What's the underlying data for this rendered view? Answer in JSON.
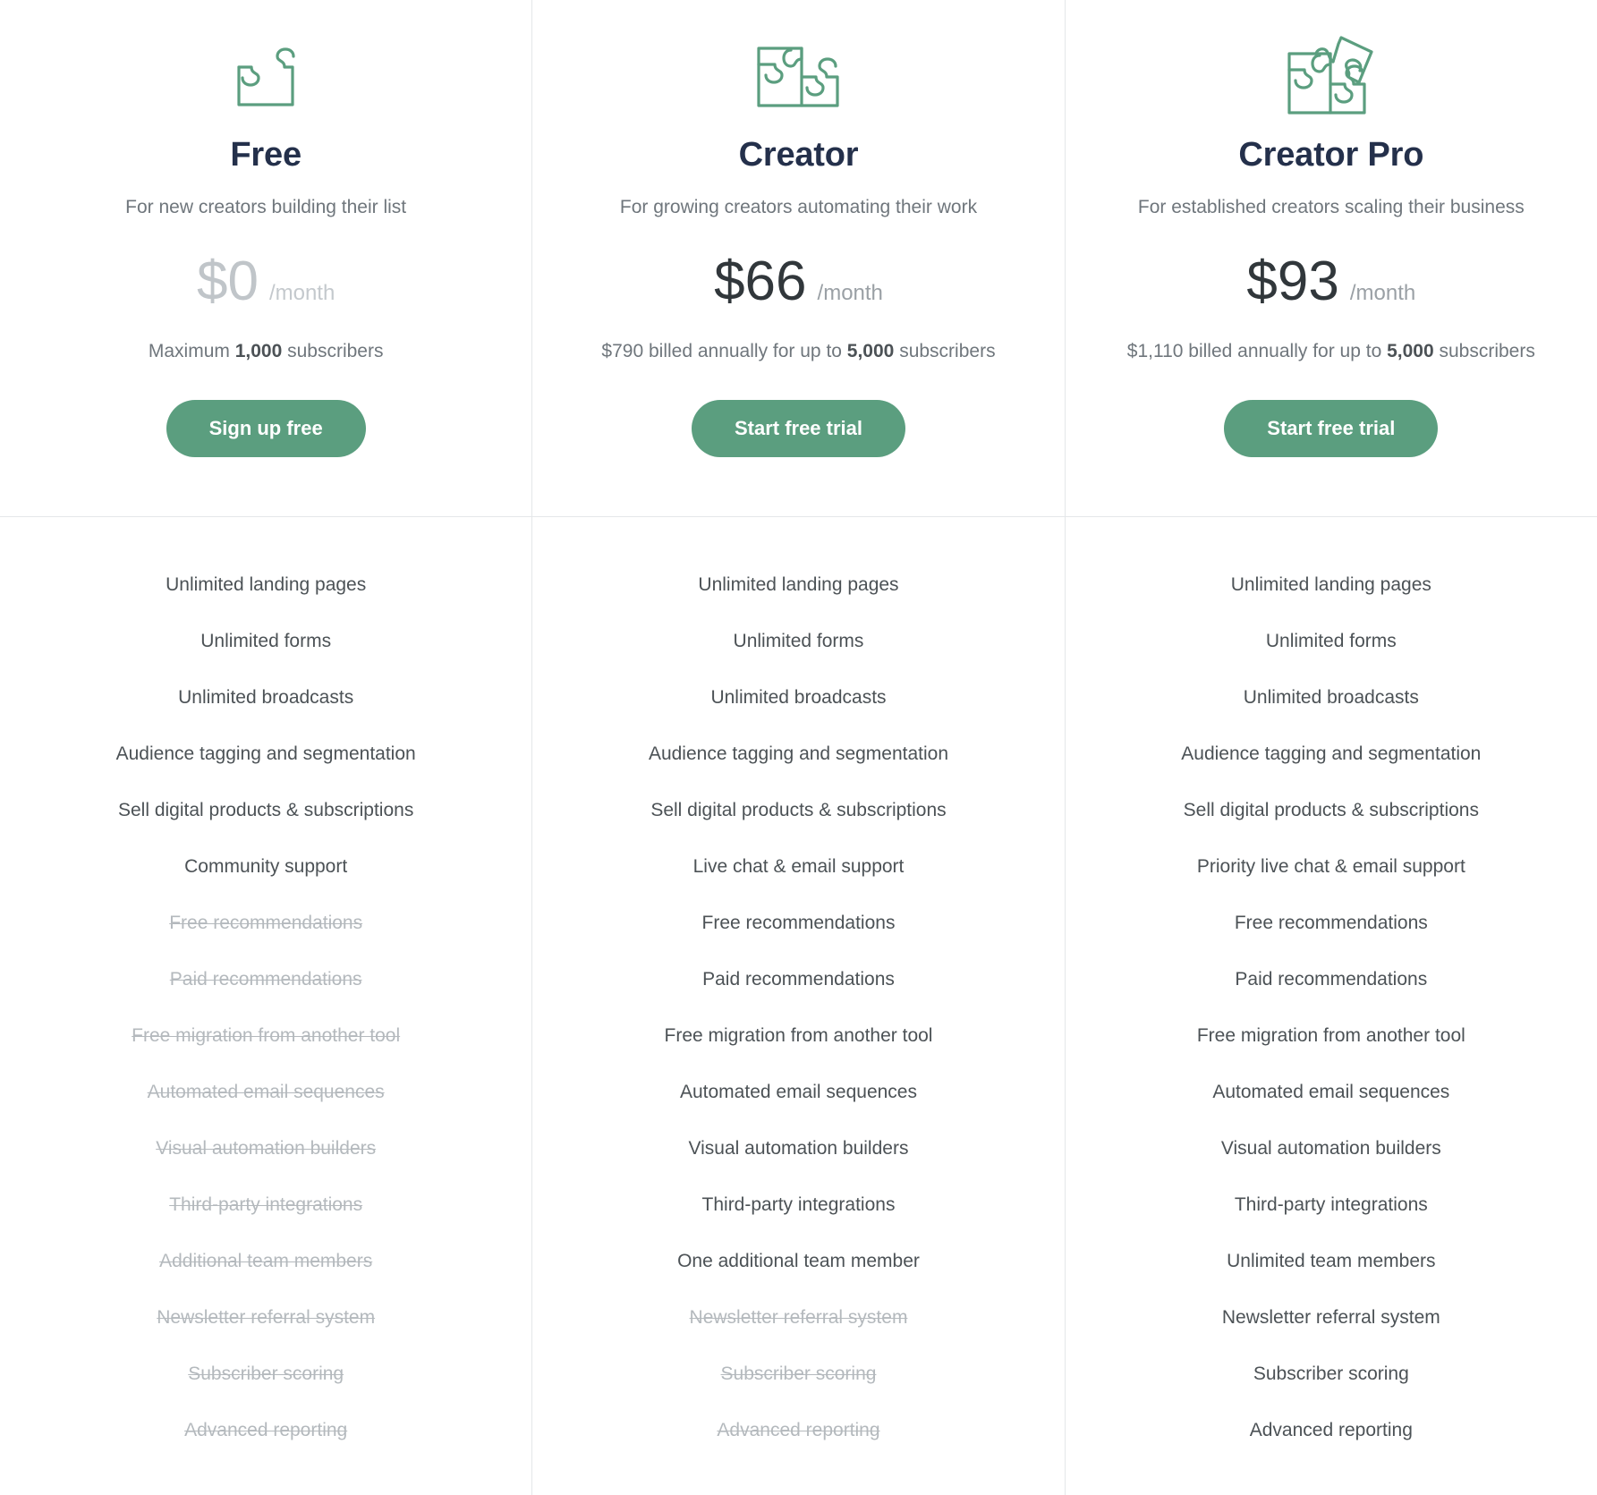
{
  "accent_color": "#5b9e7f",
  "heading_color": "#24304b",
  "body_color": "#4c5256",
  "muted_color": "#6f767c",
  "excluded_color": "#b4b9bd",
  "plans": [
    {
      "icon": "puzzle-one-piece-icon",
      "name": "Free",
      "tagline": "For new creators building their list",
      "price": "$0",
      "price_muted": true,
      "period": "/month",
      "billing_prefix": "Maximum ",
      "billing_highlight": "1,000",
      "billing_suffix": " subscribers",
      "cta_label": "Sign up free",
      "features": [
        {
          "label": "Unlimited landing pages",
          "included": true
        },
        {
          "label": "Unlimited forms",
          "included": true
        },
        {
          "label": "Unlimited broadcasts",
          "included": true
        },
        {
          "label": "Audience tagging and segmentation",
          "included": true
        },
        {
          "label": "Sell digital products & subscriptions",
          "included": true
        },
        {
          "label": "Community support",
          "included": true
        },
        {
          "label": "Free recommendations",
          "included": false
        },
        {
          "label": "Paid recommendations",
          "included": false
        },
        {
          "label": "Free migration from another tool",
          "included": false
        },
        {
          "label": "Automated email sequences",
          "included": false
        },
        {
          "label": "Visual automation builders",
          "included": false
        },
        {
          "label": "Third-party integrations",
          "included": false
        },
        {
          "label": "Additional team members",
          "included": false
        },
        {
          "label": "Newsletter referral system",
          "included": false
        },
        {
          "label": "Subscriber scoring",
          "included": false
        },
        {
          "label": "Advanced reporting",
          "included": false
        }
      ]
    },
    {
      "icon": "puzzle-two-pieces-icon",
      "name": "Creator",
      "tagline": "For growing creators automating their work",
      "price": "$66",
      "price_muted": false,
      "period": "/month",
      "billing_prefix": "$790 billed annually for up to ",
      "billing_highlight": "5,000",
      "billing_suffix": " subscribers",
      "cta_label": "Start free trial",
      "features": [
        {
          "label": "Unlimited landing pages",
          "included": true
        },
        {
          "label": "Unlimited forms",
          "included": true
        },
        {
          "label": "Unlimited broadcasts",
          "included": true
        },
        {
          "label": "Audience tagging and segmentation",
          "included": true
        },
        {
          "label": "Sell digital products & subscriptions",
          "included": true
        },
        {
          "label": "Live chat & email support",
          "included": true
        },
        {
          "label": "Free recommendations",
          "included": true
        },
        {
          "label": "Paid recommendations",
          "included": true
        },
        {
          "label": "Free migration from another tool",
          "included": true
        },
        {
          "label": "Automated email sequences",
          "included": true
        },
        {
          "label": "Visual automation builders",
          "included": true
        },
        {
          "label": "Third-party integrations",
          "included": true
        },
        {
          "label": "One additional team member",
          "included": true
        },
        {
          "label": "Newsletter referral system",
          "included": false
        },
        {
          "label": "Subscriber scoring",
          "included": false
        },
        {
          "label": "Advanced reporting",
          "included": false
        }
      ]
    },
    {
      "icon": "puzzle-three-pieces-icon",
      "name": "Creator Pro",
      "tagline": "For established creators scaling their business",
      "price": "$93",
      "price_muted": false,
      "period": "/month",
      "billing_prefix": "$1,110 billed annually for up to ",
      "billing_highlight": "5,000",
      "billing_suffix": " subscribers",
      "cta_label": "Start free trial",
      "features": [
        {
          "label": "Unlimited landing pages",
          "included": true
        },
        {
          "label": "Unlimited forms",
          "included": true
        },
        {
          "label": "Unlimited broadcasts",
          "included": true
        },
        {
          "label": "Audience tagging and segmentation",
          "included": true
        },
        {
          "label": "Sell digital products & subscriptions",
          "included": true
        },
        {
          "label": "Priority live chat & email support",
          "included": true
        },
        {
          "label": "Free recommendations",
          "included": true
        },
        {
          "label": "Paid recommendations",
          "included": true
        },
        {
          "label": "Free migration from another tool",
          "included": true
        },
        {
          "label": "Automated email sequences",
          "included": true
        },
        {
          "label": "Visual automation builders",
          "included": true
        },
        {
          "label": "Third-party integrations",
          "included": true
        },
        {
          "label": "Unlimited team members",
          "included": true
        },
        {
          "label": "Newsletter referral system",
          "included": true
        },
        {
          "label": "Subscriber scoring",
          "included": true
        },
        {
          "label": "Advanced reporting",
          "included": true
        }
      ]
    }
  ]
}
